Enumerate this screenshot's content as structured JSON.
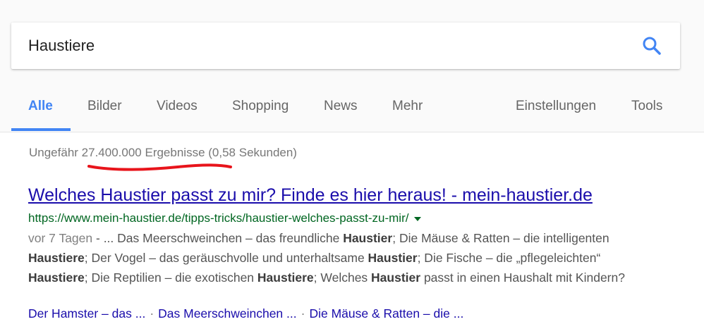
{
  "search": {
    "query": "Haustiere"
  },
  "tabs": [
    {
      "label": "Alle"
    },
    {
      "label": "Bilder"
    },
    {
      "label": "Videos"
    },
    {
      "label": "Shopping"
    },
    {
      "label": "News"
    },
    {
      "label": "Mehr"
    },
    {
      "label": "Einstellungen"
    },
    {
      "label": "Tools"
    }
  ],
  "stats": {
    "prefix": "Ungefähr",
    "count": "27.400.000 Ergebnisse",
    "time": "(0,58 Sekunden)"
  },
  "result": {
    "title": "Welches Haustier passt zu mir? Finde es hier heraus! - mein-haustier.de",
    "url": "https://www.mein-haustier.de/tipps-tricks/haustier-welches-passt-zu-mir/",
    "date": "vor 7 Tagen",
    "snippet": [
      {
        "t": " - ... Das Meerschweinchen – das freundliche "
      },
      {
        "b": "Haustier"
      },
      {
        "t": "; Die Mäuse & Ratten – die intelligenten "
      },
      {
        "b": "Haustiere"
      },
      {
        "t": "; Der Vogel – das geräuschvolle und unterhaltsame "
      },
      {
        "b": "Haustier"
      },
      {
        "t": "; Die Fische – die „pflegeleichten“ "
      },
      {
        "b": "Haustiere"
      },
      {
        "t": "; Die Reptilien – die exotischen "
      },
      {
        "b": "Haustiere"
      },
      {
        "t": "; Welches "
      },
      {
        "b": "Haustier"
      },
      {
        "t": " passt in einen Haushalt mit Kindern?"
      }
    ],
    "sitelinks": [
      "Der Hamster – das ...",
      "Das Meerschweinchen ...",
      "Die Mäuse & Ratten – die ..."
    ],
    "separator": "·"
  },
  "colors": {
    "accent": "#4285f4",
    "link": "#1a0dab",
    "url": "#006621",
    "annotation": "#e8141b"
  }
}
